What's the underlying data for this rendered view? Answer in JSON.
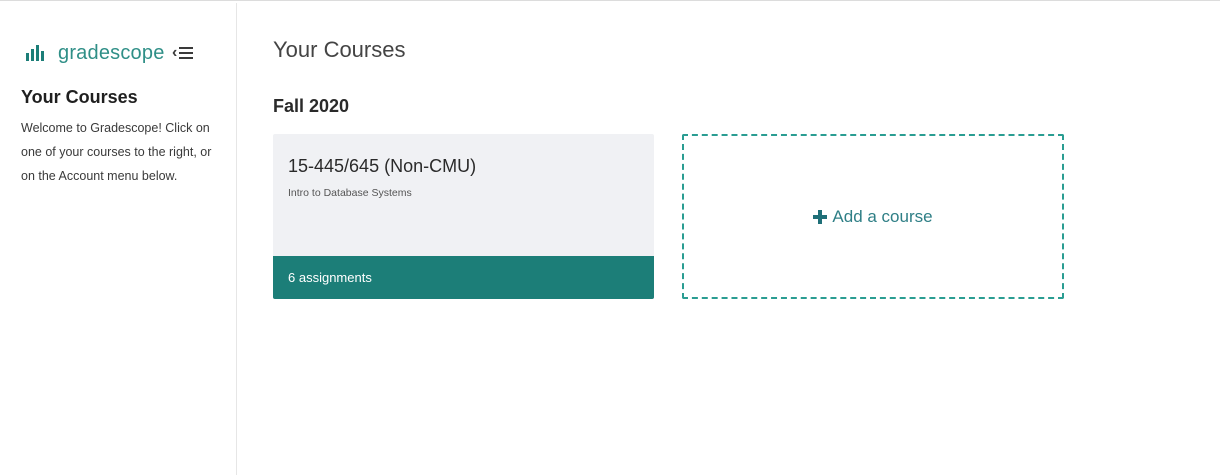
{
  "brand": {
    "name": "gradescope",
    "logo_icon": "bar-chart-icon",
    "accent_color": "#1c7e78"
  },
  "sidebar": {
    "collapse_icon": "collapse-menu-icon",
    "title": "Your Courses",
    "welcome_text": "Welcome to Gradescope! Click on one of your courses to the right, or on the Account menu below."
  },
  "main": {
    "title": "Your Courses",
    "terms": [
      {
        "name": "Fall 2020",
        "courses": [
          {
            "short_name": "15-445/645 (Non-CMU)",
            "full_name": "Intro to Database Systems",
            "assignments_label": "6 assignments"
          }
        ]
      }
    ],
    "add_course": {
      "icon": "plus-icon",
      "label": "Add a course",
      "border_color": "#2a9d92"
    }
  }
}
